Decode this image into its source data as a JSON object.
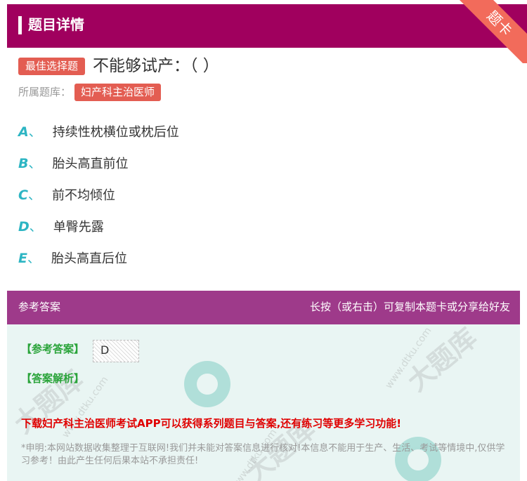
{
  "header": {
    "title": "题目详情",
    "ribbon": "题卡"
  },
  "question": {
    "type_badge": "最佳选择题",
    "text": "不能够试产：（ ）",
    "library_label": "所属题库：",
    "library": "妇产科主治医师"
  },
  "options": [
    {
      "letter": "A",
      "sep": "、",
      "text": "持续性枕横位或枕后位"
    },
    {
      "letter": "B",
      "sep": "、",
      "text": "胎头高直前位"
    },
    {
      "letter": "C",
      "sep": "、",
      "text": "前不均倾位"
    },
    {
      "letter": "D",
      "sep": "、",
      "text": "单臀先露"
    },
    {
      "letter": "E",
      "sep": "、",
      "text": "胎头高直后位"
    }
  ],
  "answer_section": {
    "title": "参考答案",
    "hint": "长按（或右击）可复制本题卡或分享给好友",
    "ref_label": "【参考答案】",
    "ref_value": "D",
    "analysis_label": "【答案解析】",
    "promo": "下载妇产科主治医师考试APP可以获得系列题目与答案,还有练习等更多学习功能!",
    "disclaimer": "*申明:本网站数据收集整理于互联网!我们并未能对答案信息进行核对!本信息不能用于生产、生活、考试等情境中,仅供学习参考！由此产生任何后果本站不承担责任!"
  },
  "watermark": {
    "brand": "大题库",
    "url": "www.dtku.com"
  },
  "colors": {
    "header": "#a0005e",
    "badge": "#e35d52",
    "answer_head": "#9e3a8a",
    "option_letter": "#2db5c3",
    "answer_green": "#2aa43a",
    "promo_red": "#e00000"
  }
}
